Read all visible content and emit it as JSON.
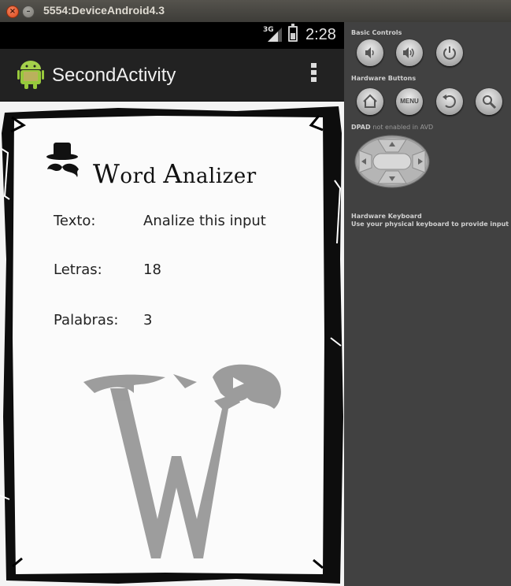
{
  "window": {
    "title": "5554:DeviceAndroid4.3",
    "close_glyph": "×",
    "minimize_glyph": "–"
  },
  "statusbar": {
    "network": "3G",
    "time": "2:28"
  },
  "actionbar": {
    "title": "SecondActivity",
    "icon": "android-robot-icon"
  },
  "app": {
    "logo_title_prefix_w": "W",
    "logo_title_word": "ord ",
    "logo_title_prefix_a": "A",
    "logo_title_rest": "nalizer",
    "rows": [
      {
        "label": "Texto:",
        "value": "Analize this input"
      },
      {
        "label": "Letras:",
        "value": "18"
      },
      {
        "label": "Palabras:",
        "value": "3"
      }
    ]
  },
  "controls": {
    "basic_title": "Basic Controls",
    "hardware_title": "Hardware Buttons",
    "menu_label": "MENU",
    "dpad_title": "DPAD",
    "dpad_note": "not enabled in AVD",
    "keyboard_title": "Hardware Keyboard",
    "keyboard_note": "Use your physical keyboard to provide input"
  },
  "colors": {
    "actionbar_bg": "#222222",
    "panel_bg": "#414141",
    "title_close": "#e0521f"
  }
}
